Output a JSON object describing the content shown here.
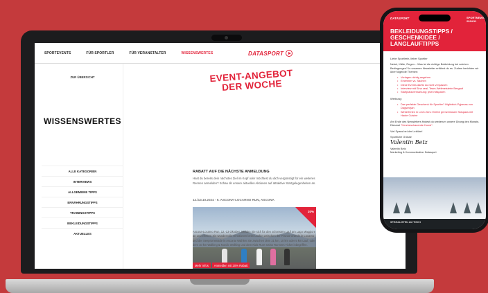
{
  "colors": {
    "background": "#c43a3c",
    "accent": "#e2233a",
    "device": "#1c1c1e"
  },
  "laptop": {
    "nav": [
      "SPORTEVENTS",
      "FÜR SPORTLER",
      "FÜR VERANSTALTER",
      "WISSENSWERTES"
    ],
    "brand": "DATASPORT",
    "sidebar": {
      "back": "ZUR ÜBERSICHT",
      "title": "WISSENSWERTES",
      "items": [
        "ALLE KATEGORIEN",
        "INTERVIEWS",
        "ALLGEMEINE TIPPS",
        "ERNÄHRUNGSTIPPS",
        "TRAININGSTIPPS",
        "BEKLEIDUNGSTIPPS",
        "AKTUELLES"
      ]
    },
    "main": {
      "hero": "EVENT-ANGEBOT DER WOCHE",
      "section_title": "RABATT AUF DIE NÄCHSTE ANMELDUNG",
      "intro": "Hast du bereits dein nächstes Ziel im Kopf oder möchtest du dich vergünstigt für ein weiteres Rennen anmelden? Schau dir unsere aktuellen Aktionen auf attraktive Startgelegenheiten an.",
      "event_title": "12./13.10.2024 - 9. ASCONA-LOCARNO RUN, ASCONA",
      "badge": "20%",
      "event_text": "Ascona-Locarno Run, 12.-13 Oktober. Melden Sie sich für den schönsten Lauf am Lago Maggiore an und erleben Sie wundervolle Emotionen beim Laufen zwischen der Piazza Grande in Locarno und der Seepromenade in Ascona! Wählen Sie zwischen dem 21 km, 10 km oder 5 km Lauf, oder dem 10 km Walking & Nordic Walking und dem Kids Run! Swiss Runners Ticket inbegriffen.",
      "buttons": [
        "Mehr Infos",
        "Anmelden mit 20% Rabatt"
      ]
    }
  },
  "phone": {
    "brand": "DATASPORT",
    "status": "SPORTNEWS 2024/11",
    "title": "BEKLEIDUNGSTIPPS / GESCHENKIDEE / LANGLAUFTIPPS",
    "greeting": "Liebe Sportlerin, lieber Sportler",
    "intro": "Nebel, Kälte, Regen... Was ist die richtige Bekleidung bei solchen Bedingungen? In unserem Newsletter erfährst du es. Zudem berichten wir über folgende Themen:",
    "topics": [
      "Vorlagen richtig angehen",
      "Einreihen vs. Sachen",
      "Diese Events darfst du nicht verpassen",
      "Interview mit Sina zeal, Team-Weltmeisterin Bergauf",
      "Startplatzvermarkung: jetzt mitsparen"
    ],
    "ads_label": "Werbung:",
    "ads": [
      "Das perfekte Geschenk für Sportler? Highbitch-Pyjamas von Dagsmejan",
      "Winterferien in Lech Zürs: Erlebe grenzenlosen Skispass mit Haute Cuisine"
    ],
    "outro": "Am Ende des Newsletters findest du wiederum unsere Übung des Monats. Diesmal ",
    "outro_link": "\"Herzbeschauende Kunst\"",
    "outro_end": ".",
    "closing": "Viel Spass bei der Lektüre!",
    "regards": "Sportliche Grüsse",
    "signature": "Valentin Betz",
    "signer": "Valentin Betz",
    "signer_role": "Marketing & Kommunikation Datasport",
    "footer": "SPEZIALISTEN AM TISCH"
  }
}
